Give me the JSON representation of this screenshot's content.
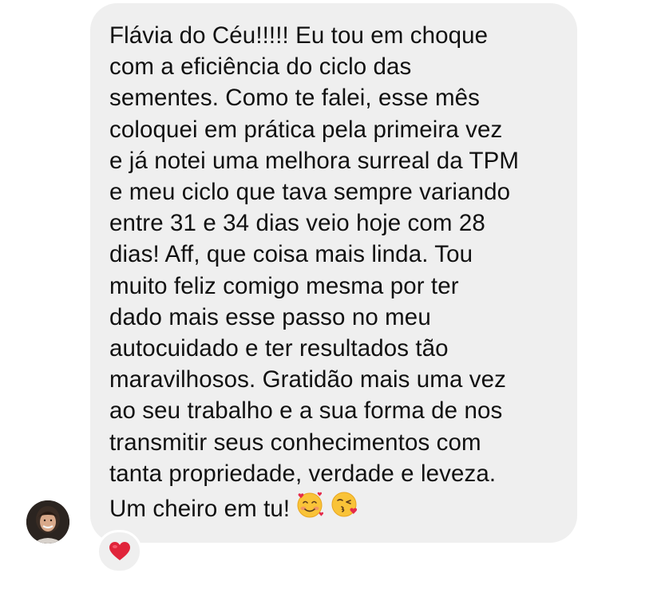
{
  "message": {
    "lines": [
      "Flávia do Céu!!!!! Eu tou em choque",
      "com a eficiência do ciclo das",
      "sementes. Como te falei, esse mês",
      "coloquei em prática pela primeira vez",
      "e já notei uma melhora surreal da TPM",
      "e meu ciclo que tava sempre variando",
      "entre 31 e 34 dias veio hoje com 28",
      "dias! Aff, que coisa mais linda. Tou",
      "muito feliz comigo mesma por ter",
      "dado mais esse passo no meu",
      "autocuidado e ter resultados tão",
      "maravilhosos. Gratidão mais uma vez",
      "ao seu trabalho e a sua forma de nos",
      "transmitir seus conhecimentos com",
      "tanta propriedade, verdade e leveza.",
      "Um cheiro em tu!"
    ],
    "emojis": [
      "smiling-face-with-hearts-icon",
      "face-blowing-kiss-icon"
    ],
    "bubble_color": "#efefef",
    "text_color": "#111111"
  },
  "reaction": {
    "icon": "red-heart-icon",
    "color": "#e0243a"
  },
  "avatar": {
    "icon": "user-avatar"
  }
}
